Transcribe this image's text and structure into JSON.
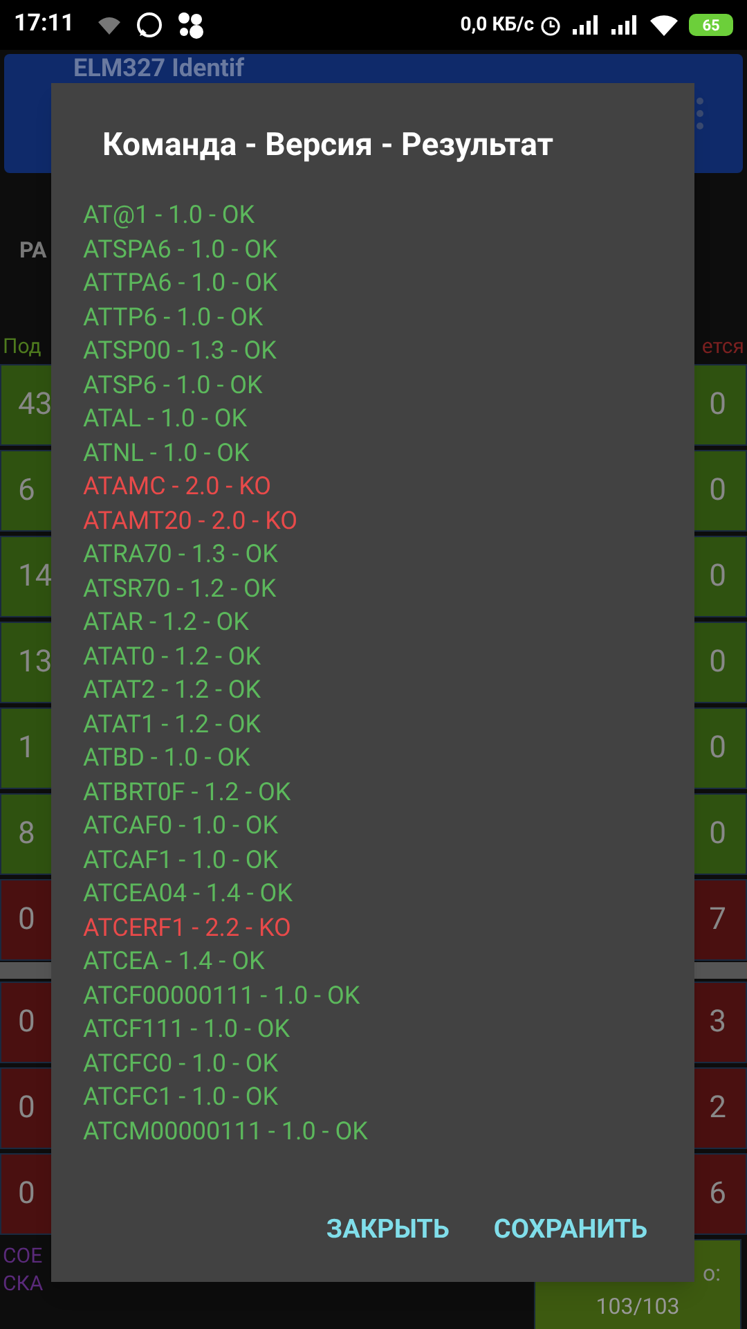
{
  "status_bar": {
    "time": "17:11",
    "network_speed": "0,0 КБ/с",
    "battery": "65"
  },
  "app_bar": {
    "title": "ELM327 Identif"
  },
  "background": {
    "tab_fragment_left": "РА",
    "label_fragment_left": "Под",
    "label_fragment_right": "ется",
    "left_tiles": [
      {
        "value": "43",
        "kind": "ok"
      },
      {
        "value": "6",
        "kind": "ok"
      },
      {
        "value": "14",
        "kind": "ok"
      },
      {
        "value": "13",
        "kind": "ok"
      },
      {
        "value": "1",
        "kind": "ok"
      },
      {
        "value": "8",
        "kind": "ok"
      },
      {
        "value": "0",
        "kind": "fail"
      },
      {
        "value": "0",
        "kind": "fail"
      },
      {
        "value": "0",
        "kind": "fail"
      },
      {
        "value": "0",
        "kind": "fail"
      }
    ],
    "right_tiles": [
      {
        "value": "0",
        "kind": "ok"
      },
      {
        "value": "0",
        "kind": "ok"
      },
      {
        "value": "0",
        "kind": "ok"
      },
      {
        "value": "0",
        "kind": "ok"
      },
      {
        "value": "0",
        "kind": "ok"
      },
      {
        "value": "0",
        "kind": "ok"
      },
      {
        "value": "7",
        "kind": "fail"
      },
      {
        "value": "3",
        "kind": "fail"
      },
      {
        "value": "2",
        "kind": "fail"
      },
      {
        "value": "6",
        "kind": "fail"
      }
    ],
    "status_lines": [
      "СОЕ",
      "СКА"
    ],
    "total_tile": {
      "label": "о:",
      "value": "103/103"
    }
  },
  "dialog": {
    "title": "Команда - Версия - Результат",
    "lines": [
      {
        "text": "AT@1 - 1.0 - OK",
        "kind": "ok"
      },
      {
        "text": "ATSPA6 - 1.0 - OK",
        "kind": "ok"
      },
      {
        "text": "ATTPA6 - 1.0 - OK",
        "kind": "ok"
      },
      {
        "text": "ATTP6 - 1.0 - OK",
        "kind": "ok"
      },
      {
        "text": "ATSP00 - 1.3 - OK",
        "kind": "ok"
      },
      {
        "text": "ATSP6 - 1.0 - OK",
        "kind": "ok"
      },
      {
        "text": "ATAL - 1.0 - OK",
        "kind": "ok"
      },
      {
        "text": "ATNL - 1.0 - OK",
        "kind": "ok"
      },
      {
        "text": "ATAMC - 2.0 - KO",
        "kind": "ko"
      },
      {
        "text": "ATAMT20 - 2.0 - KO",
        "kind": "ko"
      },
      {
        "text": "ATRA70 - 1.3 - OK",
        "kind": "ok"
      },
      {
        "text": "ATSR70 - 1.2 - OK",
        "kind": "ok"
      },
      {
        "text": "ATAR - 1.2 - OK",
        "kind": "ok"
      },
      {
        "text": "ATAT0 - 1.2 - OK",
        "kind": "ok"
      },
      {
        "text": "ATAT2 - 1.2 - OK",
        "kind": "ok"
      },
      {
        "text": "ATAT1 - 1.2 - OK",
        "kind": "ok"
      },
      {
        "text": "ATBD - 1.0 - OK",
        "kind": "ok"
      },
      {
        "text": "ATBRT0F - 1.2 - OK",
        "kind": "ok"
      },
      {
        "text": "ATCAF0 - 1.0 - OK",
        "kind": "ok"
      },
      {
        "text": "ATCAF1 - 1.0 - OK",
        "kind": "ok"
      },
      {
        "text": "ATCEA04 - 1.4 - OK",
        "kind": "ok"
      },
      {
        "text": "ATCERF1 - 2.2 - KO",
        "kind": "ko"
      },
      {
        "text": "ATCEA - 1.4 - OK",
        "kind": "ok"
      },
      {
        "text": "ATCF00000111 - 1.0 - OK",
        "kind": "ok"
      },
      {
        "text": "ATCF111 - 1.0 - OK",
        "kind": "ok"
      },
      {
        "text": "ATCFC0 - 1.0 - OK",
        "kind": "ok"
      },
      {
        "text": "ATCFC1 - 1.0 - OK",
        "kind": "ok"
      },
      {
        "text": "ATCM00000111 - 1.0 - OK",
        "kind": "ok"
      }
    ],
    "buttons": [
      "ЗАКРЫТЬ",
      "СОХРАНИТЬ"
    ]
  }
}
